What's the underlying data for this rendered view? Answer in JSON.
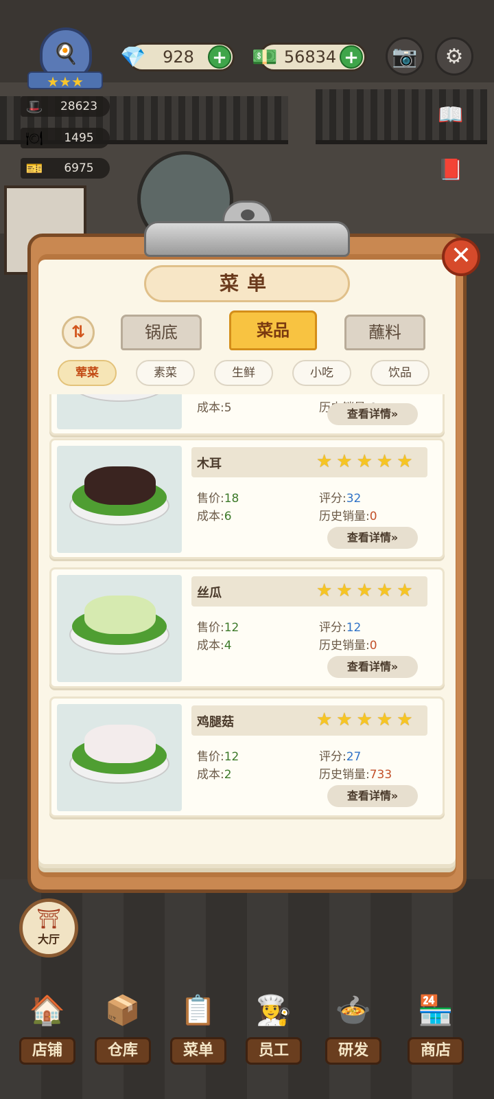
{
  "hud": {
    "badge_icon": "chef-badge-icon",
    "badge_stars": "★★★",
    "gems": "928",
    "money": "56834",
    "stats": [
      "28623",
      "1495",
      "6975"
    ]
  },
  "menu": {
    "title": "菜单",
    "sort_icon": "⇅",
    "close_icon": "✕",
    "tabs": [
      "锅底",
      "菜品",
      "蘸料"
    ],
    "active_tab": "菜品",
    "categories": [
      "荤菜",
      "素菜",
      "生鲜",
      "小吃",
      "饮品"
    ],
    "active_category": "荤菜",
    "labels": {
      "price": "售价:",
      "cost": "成本:",
      "rating": "评分:",
      "sales": "历史销量:",
      "detail": "查看详情»"
    },
    "partial_card": {
      "cost": "成本:5",
      "sales": "历史销量:0"
    },
    "items": [
      {
        "name": "木耳",
        "stars": "★★★★★",
        "price": "18",
        "cost": "6",
        "rating": "32",
        "sales": "0"
      },
      {
        "name": "丝瓜",
        "stars": "★★★★★",
        "price": "12",
        "cost": "4",
        "rating": "12",
        "sales": "0"
      },
      {
        "name": "鸡腿菇",
        "stars": "★★★★★",
        "price": "12",
        "cost": "2",
        "rating": "27",
        "sales": "733"
      }
    ]
  },
  "hall": {
    "label": "大厅"
  },
  "nav": [
    "店铺",
    "仓库",
    "菜单",
    "员工",
    "研发",
    "商店"
  ],
  "colors": {
    "accent": "#f8c341",
    "close": "#d64a2b",
    "plus": "#3fa54a"
  }
}
